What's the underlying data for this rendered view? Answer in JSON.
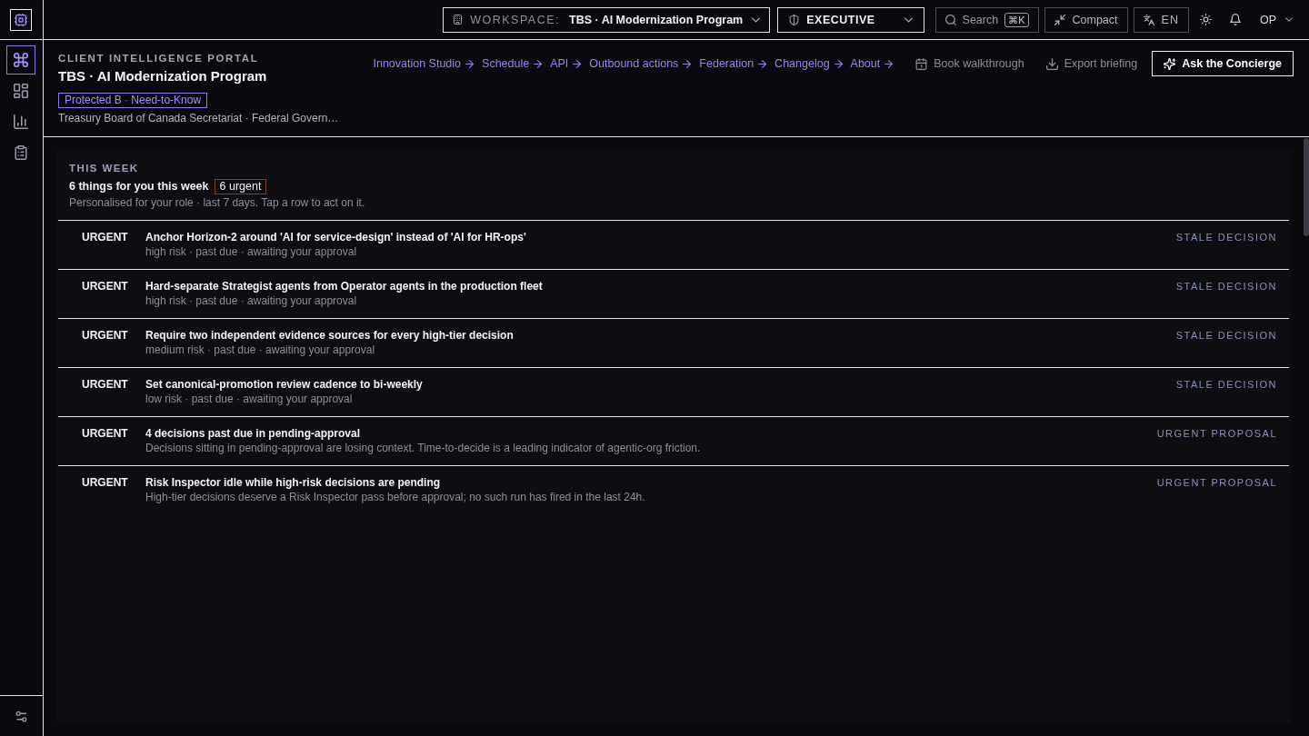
{
  "rail": {
    "items": [
      {
        "selected": true
      },
      {
        "selected": false
      },
      {
        "selected": false
      },
      {
        "selected": false
      }
    ]
  },
  "top_bar": {
    "workspace": {
      "label": "WORKSPACE:",
      "value": "TBS · AI Modernization Program"
    },
    "role": "EXECUTIVE",
    "search": {
      "label": "Search",
      "shortcut": "⌘K"
    },
    "compact": "Compact",
    "language": "EN",
    "user": "OP"
  },
  "header": {
    "eyebrow": "CLIENT INTELLIGENCE PORTAL",
    "title": "TBS · AI Modernization Program",
    "classification": "Protected B · Need-to-Know",
    "organization": "Treasury Board of Canada Secretariat · Federal Govern…",
    "links": [
      "Innovation Studio",
      "Schedule",
      "API",
      "Outbound actions",
      "Federation",
      "Changelog",
      "About"
    ],
    "actions": [
      "Book walkthrough",
      "Export briefing"
    ],
    "primary_action": "Ask the Concierge"
  },
  "this_week": {
    "heading": "THIS WEEK",
    "summary": "6 things for you this week",
    "urgent_count": "6 urgent",
    "note": "Personalised for your role · last 7 days. Tap a row to act on it.",
    "items": [
      {
        "severity": "URGENT",
        "title": "Anchor Horizon-2 around 'AI for service-design' instead of 'AI for HR-ops'",
        "detail": "high risk · past due · awaiting your approval",
        "category": "STALE DECISION"
      },
      {
        "severity": "URGENT",
        "title": "Hard-separate Strategist agents from Operator agents in the production fleet",
        "detail": "high risk · past due · awaiting your approval",
        "category": "STALE DECISION"
      },
      {
        "severity": "URGENT",
        "title": "Require two independent evidence sources for every high-tier decision",
        "detail": "medium risk · past due · awaiting your approval",
        "category": "STALE DECISION"
      },
      {
        "severity": "URGENT",
        "title": "Set canonical-promotion review cadence to bi-weekly",
        "detail": "low risk · past due · awaiting your approval",
        "category": "STALE DECISION"
      },
      {
        "severity": "URGENT",
        "title": "4 decisions past due in pending-approval",
        "detail": "Decisions sitting in pending-approval are losing context. Time-to-decide is a leading indicator of agentic-org friction.",
        "category": "URGENT PROPOSAL"
      },
      {
        "severity": "URGENT",
        "title": "Risk Inspector idle while high-risk decisions are pending",
        "detail": "High-tier decisions deserve a Risk Inspector pass before approval; no such run has fired in the last 24h.",
        "category": "URGENT PROPOSAL"
      }
    ]
  }
}
